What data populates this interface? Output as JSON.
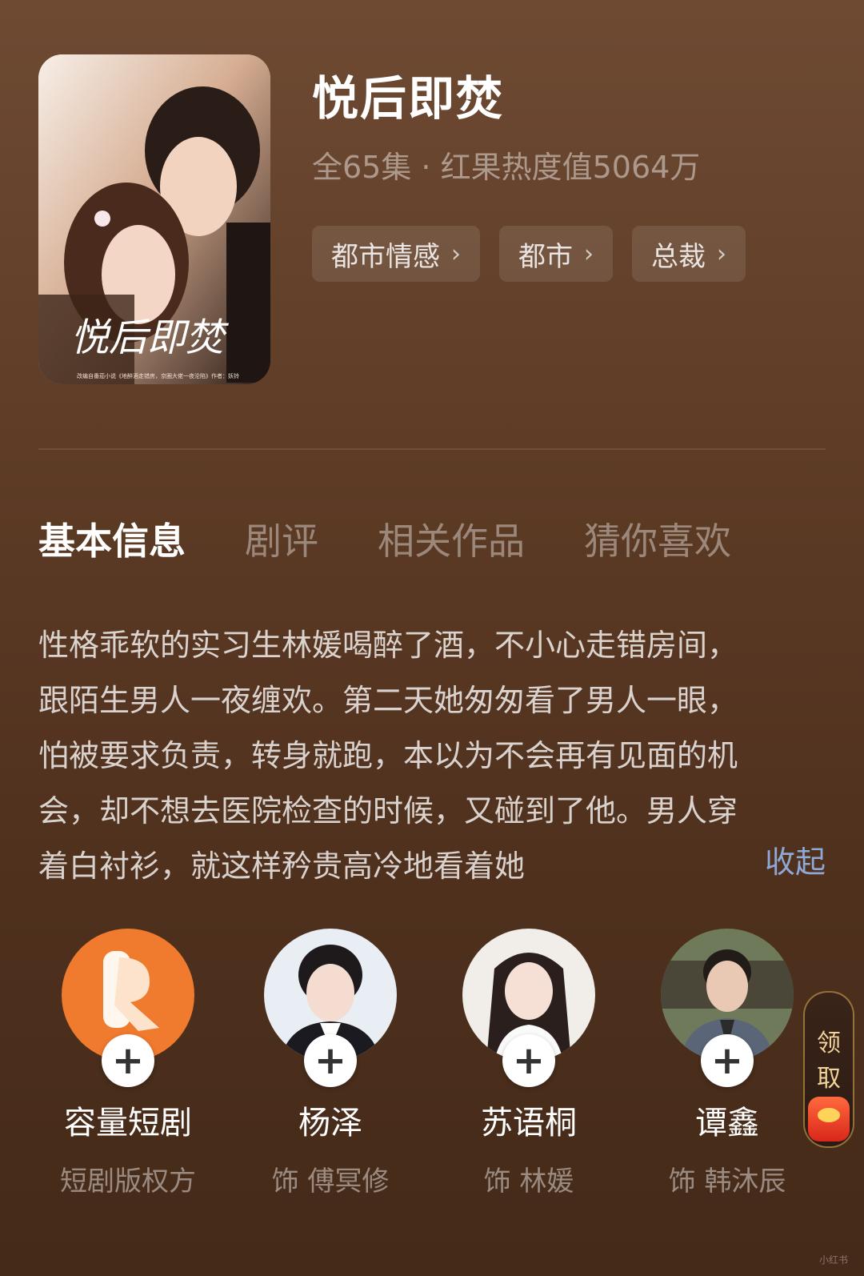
{
  "drama": {
    "title": "悦后即焚",
    "meta": "全65集 · 红果热度值5064万",
    "poster": {
      "calligraphy": "悦后即焚",
      "caption": "改编自番茄小说《地醉酒走错房，京圈大佬一夜沦陷》作者：妖铃"
    },
    "tags": [
      {
        "label": "都市情感"
      },
      {
        "label": "都市"
      },
      {
        "label": "总裁"
      }
    ]
  },
  "tabs": [
    {
      "label": "基本信息",
      "active": true
    },
    {
      "label": "剧评",
      "active": false
    },
    {
      "label": "相关作品",
      "active": false
    },
    {
      "label": "猜你喜欢",
      "active": false
    }
  ],
  "description": {
    "lines": [
      "性格乖软的实习生林媛喝醉了酒，不小心走错房间，",
      "跟陌生男人一夜缠欢。第二天她匆匆看了男人一眼，",
      "怕被要求负责，转身就跑，本以为不会再有见面的机",
      "会，却不想去医院检查的时候，又碰到了他。男人穿",
      "着白衬衫，就这样矜贵高冷地看着她"
    ],
    "collapse_label": "收起"
  },
  "cast": [
    {
      "name": "容量短剧",
      "role": "短剧版权方",
      "avatar_icon": "rongliang-logo-icon"
    },
    {
      "name": "杨泽",
      "role": "饰 傅冥修",
      "avatar_icon": "actor-photo-icon"
    },
    {
      "name": "苏语桐",
      "role": "饰 林媛",
      "avatar_icon": "actor-photo-icon"
    },
    {
      "name": "谭鑫",
      "role": "饰 韩沐辰",
      "avatar_icon": "actor-photo-icon"
    }
  ],
  "follow_icon": "plus-icon",
  "float_widget": {
    "line1": "领",
    "line2": "取",
    "icon": "red-envelope-icon"
  },
  "watermark": "小红书",
  "colors": {
    "background_top": "#6e4a33",
    "background_bottom": "#452a19",
    "accent_link": "#8ea9d6",
    "logo_orange": "#f07a2e"
  }
}
